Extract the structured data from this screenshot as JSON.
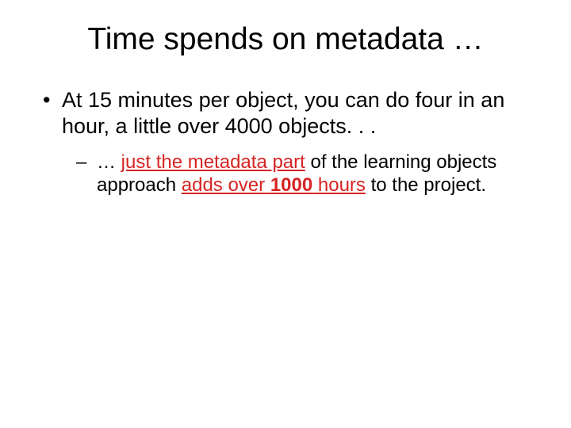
{
  "title": "Time spends on metadata …",
  "lvl1_a": "At 15 minutes per object, you can do four in an hour, a little over 4000 objects. . .",
  "lvl2_pre": "… ",
  "lvl2_u1": "just the metadata part",
  "lvl2_mid": " of the learning objects approach ",
  "lvl2_u2a": "adds over ",
  "lvl2_u2b": "1000",
  "lvl2_u2c": " hours",
  "lvl2_post": " to the project."
}
